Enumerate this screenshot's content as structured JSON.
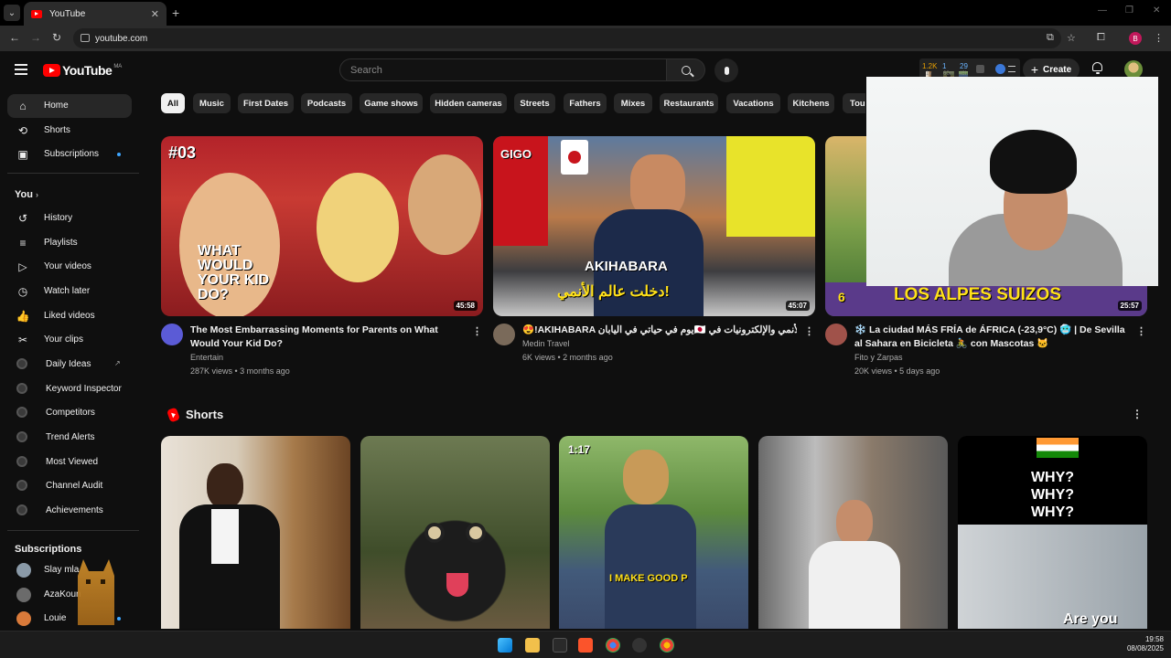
{
  "browser": {
    "tab_title": "YouTube",
    "url": "youtube.com",
    "profile_initial": "B"
  },
  "header": {
    "logo_text": "YouTube",
    "logo_region": "MA",
    "search_placeholder": "Search",
    "create_label": "Create",
    "ext_stats": {
      "v1": "1.2K",
      "s1": "1y",
      "v2": "1",
      "s2": "60m",
      "v3": "29",
      "s3": "48h"
    }
  },
  "sidebar": {
    "main": [
      {
        "label": "Home",
        "icon": "home-icon"
      },
      {
        "label": "Shorts",
        "icon": "shorts-icon"
      },
      {
        "label": "Subscriptions",
        "icon": "subscriptions-icon"
      }
    ],
    "you_header": "You",
    "you": [
      {
        "label": "History",
        "icon": "history-icon"
      },
      {
        "label": "Playlists",
        "icon": "playlists-icon"
      },
      {
        "label": "Your videos",
        "icon": "your-videos-icon"
      },
      {
        "label": "Watch later",
        "icon": "watch-later-icon"
      },
      {
        "label": "Liked videos",
        "icon": "liked-videos-icon"
      },
      {
        "label": "Your clips",
        "icon": "clips-icon"
      }
    ],
    "tools": [
      {
        "label": "Daily Ideas"
      },
      {
        "label": "Keyword Inspector"
      },
      {
        "label": "Competitors"
      },
      {
        "label": "Trend Alerts"
      },
      {
        "label": "Most Viewed"
      },
      {
        "label": "Channel Audit"
      },
      {
        "label": "Achievements"
      }
    ],
    "subs_header": "Subscriptions",
    "subs": [
      {
        "label": "Slay mla"
      },
      {
        "label": "AzaKoun"
      },
      {
        "label": "Louie"
      }
    ]
  },
  "chips": [
    "All",
    "Music",
    "First Dates",
    "Podcasts",
    "Game shows",
    "Hidden cameras",
    "Streets",
    "Fathers",
    "Mixes",
    "Restaurants",
    "Vacations",
    "Kitchens",
    "Tour"
  ],
  "videos": [
    {
      "title": "The Most Embarrassing Moments for Parents on What Would Your Kid Do?",
      "channel": "Entertain",
      "meta": "287K views • 3 months ago",
      "duration": "45:58",
      "overlay1": "#03",
      "overlay2": "WHAT WOULD YOUR KID DO?"
    },
    {
      "title": "😍!AKIHABARA يوم في حياتي في اليابان🇯🇵 دخلت جنة الأنمي والإلكترونيات في",
      "channel": "Medin Travel",
      "meta": "6K views • 2 months ago",
      "duration": "45:07",
      "overlay1": "AKIHABARA",
      "overlay2": "دخلت عالم الأنمي!",
      "sign": "GIGO"
    },
    {
      "title": "❄️ La ciudad MÁS FRÍA de ÁFRICA (-23,9°C) 🥶 | De Sevilla al Sahara en Bicicleta 🚴 con Mascotas 🐱",
      "channel": "Fito y Zarpas",
      "meta": "20K views • 5 days ago",
      "duration": "25:57",
      "overlay1": "LOS ALPES SUIZOS",
      "overlay2": "6"
    }
  ],
  "shorts": {
    "title": "Shorts",
    "items": [
      {
        "caption": ""
      },
      {
        "caption": ""
      },
      {
        "caption": "I MAKE GOOD P",
        "badge": "1:17"
      },
      {
        "caption": ""
      },
      {
        "caption": "Are you",
        "top": "WHY?\nWHY?\nWHY?"
      }
    ]
  },
  "taskbar": {
    "time": "19:58",
    "date": "08/08/2025"
  }
}
